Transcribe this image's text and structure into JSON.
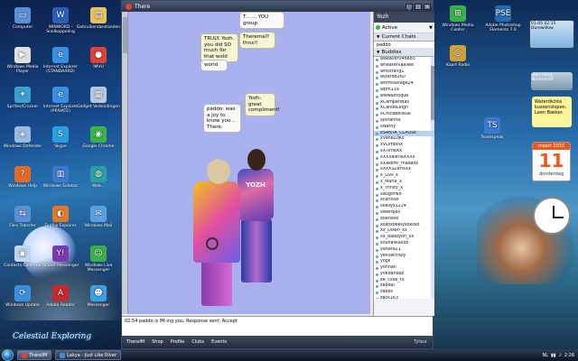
{
  "desktop_icons_left": [
    {
      "label": "Computer",
      "color": "#5a8fd6",
      "glyph": "▭"
    },
    {
      "label": "WINWORD - Snelkoppeling",
      "color": "#2b5fb6",
      "glyph": "W"
    },
    {
      "label": "Gebruikersbestanden",
      "color": "#e8c25a",
      "glyph": "▤"
    },
    {
      "label": "Windows Media Player",
      "color": "#e0e0e0",
      "glyph": "▶"
    },
    {
      "label": "Internet Explorer (STANDAARD)",
      "color": "#3a8fe0",
      "glyph": "e"
    },
    {
      "label": "IMVU",
      "color": "#d43",
      "glyph": "●"
    },
    {
      "label": "Sprites/Cracker",
      "color": "#3aa0d0",
      "glyph": "✦"
    },
    {
      "label": "Internet Explorer (PRIVATE)",
      "color": "#3a8fe0",
      "glyph": "e"
    },
    {
      "label": "Gadget Verbindingen",
      "color": "#b5c8e0",
      "glyph": "▦"
    },
    {
      "label": "Windows Defender",
      "color": "#9ab8e0",
      "glyph": "◈"
    },
    {
      "label": "Skype",
      "color": "#2aa0e0",
      "glyph": "S"
    },
    {
      "label": "Google Chrome",
      "color": "#3ab34a",
      "glyph": "◉"
    },
    {
      "label": "Windows Help",
      "color": "#e06a2a",
      "glyph": "?"
    },
    {
      "label": "Windows Sidebar",
      "color": "#3a7ad0",
      "glyph": "▥"
    },
    {
      "label": "Web...",
      "color": "#2aa0a0",
      "glyph": "◍"
    },
    {
      "label": "Files Transfer",
      "color": "#5a8fd6",
      "glyph": "⇆"
    },
    {
      "label": "Firefox Explorer",
      "color": "#e07a2a",
      "glyph": "◐"
    },
    {
      "label": "Windows Mail",
      "color": "#5aa0e0",
      "glyph": "✉"
    },
    {
      "label": "Contacts Calendar",
      "color": "#c0d6ee",
      "glyph": "▣"
    },
    {
      "label": "Yahoo! Messenger",
      "color": "#7a3ab0",
      "glyph": "Y!"
    },
    {
      "label": "Windows Live Messenger",
      "color": "#3ab04a",
      "glyph": "☺"
    },
    {
      "label": "Windows Update",
      "color": "#3a8fe0",
      "glyph": "⟳"
    },
    {
      "label": "Adobe Reader",
      "color": "#c42a2a",
      "glyph": "A"
    },
    {
      "label": "Messenger",
      "color": "#3aa0e0",
      "glyph": "☻"
    }
  ],
  "desktop_icons_right": [
    {
      "label": "Windows Media Center",
      "color": "#3ab04a",
      "glyph": "⊞"
    },
    {
      "label": "Adobe Photoshop Elements 7.0",
      "color": "#2a6ab0",
      "glyph": "PSE"
    },
    {
      "label": "Kaart Radio",
      "color": "#d0a03a",
      "glyph": "◎"
    },
    {
      "label": "Teamspeak",
      "color": "#3a7ad0",
      "glyph": "TS"
    }
  ],
  "imvu": {
    "window_title": "There",
    "panel_title": "Yozh",
    "status": "Active",
    "current_chats_label": "Current Chats",
    "current_chat": "paddo",
    "buddies_label": "Buddies",
    "buddies": [
      "waeaver046883",
      "wheatervaallee",
      "whistfang1",
      "wizard8260",
      "wormsavage24",
      "wpm119",
      "wwwaitloque",
      "xCampariBav",
      "xCandoLeigh",
      "xChicaBellaSk",
      "xJohanna",
      "xNathy",
      "xSANTA_CLAUSx",
      "xVaheZoKs",
      "xVLimbolx",
      "xXTimeXx",
      "xXXValerieXXXx",
      "xXakemi_madalix",
      "xXxXSZertsXx",
      "x_Livs_x",
      "x_Maria_x",
      "x_Trinity_x",
      "xaugorwo",
      "xcarlitax",
      "xkellyx1224",
      "xleerdjex",
      "xoRnexo",
      "xoxoxbeelyxoxoxo",
      "xx_Dixen_xx",
      "xx_babbyorl_xx",
      "xxxnaskaxxx",
      "yahara21",
      "yellowcrazy",
      "yogil",
      "yonnan",
      "yvedandez",
      "zR_cxke_tV",
      "zabdal",
      "zabos",
      "zack163",
      "zacmark1122",
      "zacrc26A4"
    ],
    "selected_buddy": "xSANTA_CLAUSx",
    "bubbles": {
      "b1": "T... ... YOU group",
      "b2": "Theremal? thnx!!",
      "b3": "TRULY. Yozh. you did SO much for that wold",
      "b4": "world",
      "b5": "paddo: was a joy to know you .. There.",
      "b6": "Yozh: great compliment!"
    },
    "avatar_shirt_text": "YOZH",
    "chat_log": "02:54 paddo is IM-ing you. Response sent: Accept",
    "footer_tabs": [
      "ThereIM",
      "Shop",
      "Profile",
      "Clubs",
      "Events"
    ],
    "footer_user": "Tylaur"
  },
  "gadgets": {
    "clock_digital": "01-05 02:15 Durewillow",
    "weather": "Den Haag, Nederland",
    "note": "Waterdichte kussenslopen. Leen Bakker.",
    "calendar_month": "maart 2010",
    "calendar_day": "11",
    "calendar_dow": "donderdag"
  },
  "taskbar": {
    "buttons": [
      {
        "label": "ThereIM",
        "color": "#d43",
        "active": true
      },
      {
        "label": "Lakya - Just Like River",
        "color": "#3a8fe0",
        "active": false
      }
    ],
    "lang": "NL",
    "time": "2:26"
  },
  "wallpaper_caption": "Celestial Exploring"
}
